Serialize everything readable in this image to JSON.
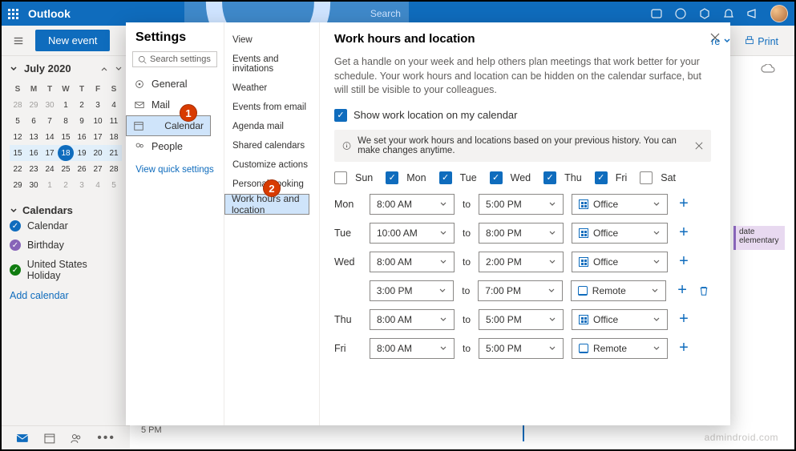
{
  "topbar": {
    "brand": "Outlook",
    "search_placeholder": "Search"
  },
  "cmdbar": {
    "new_event": "New event"
  },
  "sidebar_cal": {
    "month_title": "July 2020",
    "dow": [
      "S",
      "M",
      "T",
      "W",
      "T",
      "F",
      "S"
    ],
    "weeks": [
      [
        "28",
        "29",
        "30",
        "1",
        "2",
        "3",
        "4"
      ],
      [
        "5",
        "6",
        "7",
        "8",
        "9",
        "10",
        "11"
      ],
      [
        "12",
        "13",
        "14",
        "15",
        "16",
        "17",
        "18"
      ],
      [
        "15",
        "16",
        "17",
        "18",
        "19",
        "20",
        "21"
      ],
      [
        "22",
        "23",
        "24",
        "25",
        "26",
        "27",
        "28"
      ],
      [
        "29",
        "30",
        "1",
        "2",
        "3",
        "4",
        "5"
      ]
    ],
    "today_idx": [
      3,
      3
    ],
    "selweek_idx": 3,
    "section": "Calendars",
    "items": [
      {
        "label": "Calendar",
        "color": "#0f6cbd"
      },
      {
        "label": "Birthday",
        "color": "#8764b8"
      },
      {
        "label": "United States Holiday",
        "color": "#107c10"
      }
    ],
    "add": "Add calendar"
  },
  "overlay_event": {
    "line1": "date",
    "line2": "elementary"
  },
  "shareprint": {
    "share_tail": "re ",
    "print": "Print"
  },
  "time_label": "5 PM",
  "watermark": "admindroid.com",
  "settings": {
    "title": "Settings",
    "search_placeholder": "Search settings",
    "categories": [
      "General",
      "Mail",
      "Calendar",
      "People"
    ],
    "selected_cat": 2,
    "view_quick": "View quick settings",
    "subitems": [
      "View",
      "Events and invitations",
      "Weather",
      "Events from email",
      "Agenda mail",
      "Shared calendars",
      "Customize actions",
      "Personal booking",
      "Work hours and location"
    ],
    "selected_sub": 8
  },
  "workhours": {
    "heading": "Work hours and location",
    "desc": "Get a handle on your week and help others plan meetings that work better for your schedule. Your work hours and location can be hidden on the calendar surface, but will still be visible to your colleagues.",
    "checkbox_label": "Show work location on my calendar",
    "info": "We set your work hours and locations based on your previous history. You can make changes anytime.",
    "days": [
      {
        "label": "Sun",
        "on": false
      },
      {
        "label": "Mon",
        "on": true
      },
      {
        "label": "Tue",
        "on": true
      },
      {
        "label": "Wed",
        "on": true
      },
      {
        "label": "Thu",
        "on": true
      },
      {
        "label": "Fri",
        "on": true
      },
      {
        "label": "Sat",
        "on": false
      }
    ],
    "to": "to",
    "rows": [
      {
        "day": "Mon",
        "blocks": [
          {
            "start": "8:00 AM",
            "end": "5:00 PM",
            "loc": "Office",
            "kind": "office"
          }
        ]
      },
      {
        "day": "Tue",
        "blocks": [
          {
            "start": "10:00 AM",
            "end": "8:00 PM",
            "loc": "Office",
            "kind": "office"
          }
        ]
      },
      {
        "day": "Wed",
        "blocks": [
          {
            "start": "8:00 AM",
            "end": "2:00 PM",
            "loc": "Office",
            "kind": "office"
          },
          {
            "start": "3:00 PM",
            "end": "7:00 PM",
            "loc": "Remote",
            "kind": "remote",
            "trash": true
          }
        ]
      },
      {
        "day": "Thu",
        "blocks": [
          {
            "start": "8:00 AM",
            "end": "5:00 PM",
            "loc": "Office",
            "kind": "office"
          }
        ]
      },
      {
        "day": "Fri",
        "blocks": [
          {
            "start": "8:00 AM",
            "end": "5:00 PM",
            "loc": "Remote",
            "kind": "remote"
          }
        ]
      }
    ]
  },
  "annotations": {
    "n1": "1",
    "n2": "2"
  }
}
